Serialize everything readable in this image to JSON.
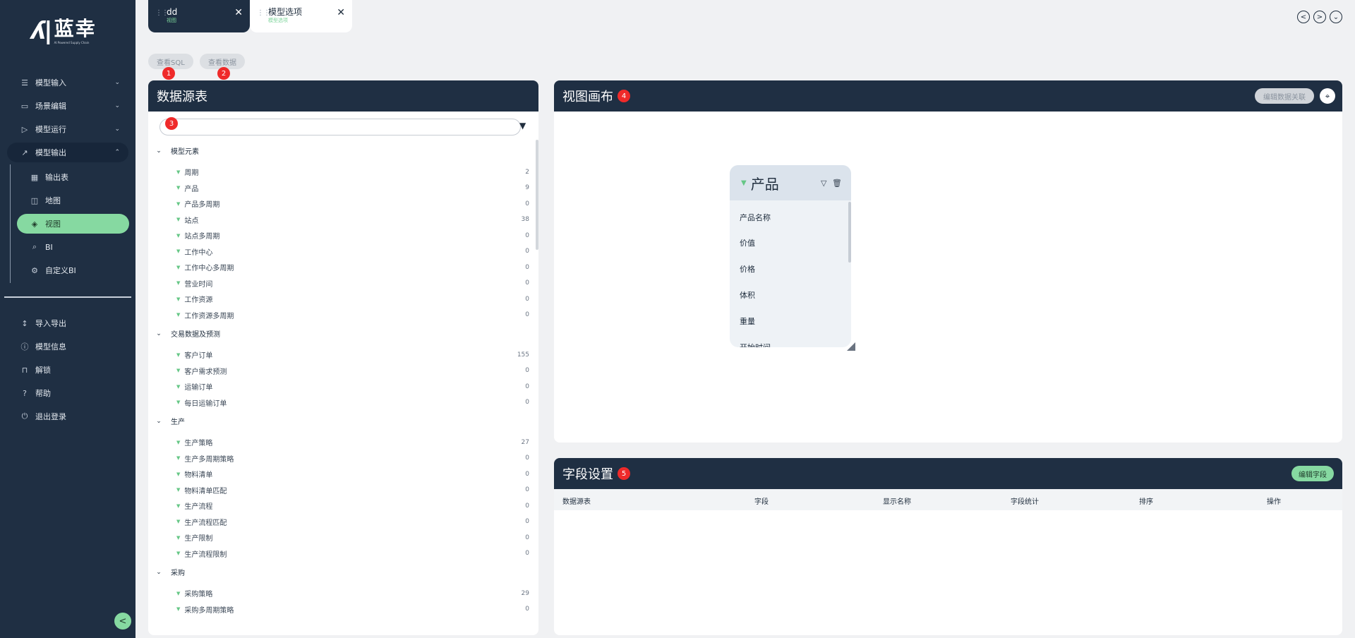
{
  "brand": {
    "name": "蓝幸",
    "mark": "ʎ|",
    "tagline": "AI Powered Supply Chain"
  },
  "sidebar": {
    "items": [
      {
        "label": "模型输入",
        "icon": "list-icon",
        "glyph": "☰",
        "chevron": "⌄"
      },
      {
        "label": "场景编辑",
        "icon": "monitor-icon",
        "glyph": "▭",
        "chevron": "⌄"
      },
      {
        "label": "模型运行",
        "icon": "play-icon",
        "glyph": "▷",
        "chevron": "⌄"
      },
      {
        "label": "模型输出",
        "icon": "chart-icon",
        "glyph": "↗",
        "chevron": "⌃"
      }
    ],
    "sub_items": [
      {
        "label": "输出表",
        "icon": "table-icon",
        "glyph": "▦"
      },
      {
        "label": "地图",
        "icon": "map-icon",
        "glyph": "◫"
      },
      {
        "label": "视图",
        "icon": "view-icon",
        "glyph": "◈"
      },
      {
        "label": "BI",
        "icon": "bi-icon",
        "glyph": "⌕"
      },
      {
        "label": "自定义BI",
        "icon": "custom-bi-icon",
        "glyph": "⚙"
      }
    ],
    "bottom_items": [
      {
        "label": "导入导出",
        "icon": "import-export-icon",
        "glyph": "↕"
      },
      {
        "label": "模型信息",
        "icon": "info-icon",
        "glyph": "ⓘ"
      },
      {
        "label": "解锁",
        "icon": "unlock-icon",
        "glyph": "⊓"
      },
      {
        "label": "帮助",
        "icon": "help-icon",
        "glyph": "?"
      },
      {
        "label": "退出登录",
        "icon": "logout-icon",
        "glyph": "⏻"
      }
    ],
    "collapse_glyph": "<"
  },
  "tabs": [
    {
      "title": "dd",
      "subtitle": "视图",
      "close": "✕"
    },
    {
      "title": "模型选项",
      "subtitle": "模型选项",
      "close": "✕"
    }
  ],
  "top_nav": {
    "prev": "<",
    "next": ">",
    "more": "⌄"
  },
  "toolbar": {
    "view_sql": "查看SQL",
    "view_data": "查看数据",
    "badge1": "1",
    "badge2": "2"
  },
  "source_panel": {
    "title": "数据源表",
    "search_badge": "3",
    "search_placeholder": "",
    "filter_glyph": "▼",
    "groups": [
      {
        "label": "模型元素",
        "items": [
          {
            "name": "周期",
            "count": "2"
          },
          {
            "name": "产品",
            "count": "9"
          },
          {
            "name": "产品多周期",
            "count": "0"
          },
          {
            "name": "站点",
            "count": "38"
          },
          {
            "name": "站点多周期",
            "count": "0"
          },
          {
            "name": "工作中心",
            "count": "0"
          },
          {
            "name": "工作中心多周期",
            "count": "0"
          },
          {
            "name": "营业时间",
            "count": "0"
          },
          {
            "name": "工作资源",
            "count": "0"
          },
          {
            "name": "工作资源多周期",
            "count": "0"
          }
        ]
      },
      {
        "label": "交易数据及预测",
        "items": [
          {
            "name": "客户订单",
            "count": "155"
          },
          {
            "name": "客户需求预测",
            "count": "0"
          },
          {
            "name": "运输订单",
            "count": "0"
          },
          {
            "name": "每日运输订单",
            "count": "0"
          }
        ]
      },
      {
        "label": "生产",
        "items": [
          {
            "name": "生产策略",
            "count": "27"
          },
          {
            "name": "生产多周期策略",
            "count": "0"
          },
          {
            "name": "物料清单",
            "count": "0"
          },
          {
            "name": "物料清单匹配",
            "count": "0"
          },
          {
            "name": "生产流程",
            "count": "0"
          },
          {
            "name": "生产流程匹配",
            "count": "0"
          },
          {
            "name": "生产限制",
            "count": "0"
          },
          {
            "name": "生产流程限制",
            "count": "0"
          }
        ]
      },
      {
        "label": "采购",
        "items": [
          {
            "name": "采购策略",
            "count": "29"
          },
          {
            "name": "采购多周期策略",
            "count": "0"
          }
        ]
      }
    ]
  },
  "canvas_panel": {
    "title": "视图画布",
    "badge": "4",
    "edit_relation": "编辑数据关联",
    "locate_glyph": "⌖",
    "node": {
      "title": "产品",
      "filter_glyph": "▽",
      "delete_glyph": "🗑",
      "fields": [
        "产品名称",
        "价值",
        "价格",
        "体积",
        "重量",
        "开始时间"
      ]
    }
  },
  "fields_panel": {
    "title": "字段设置",
    "badge": "5",
    "edit_fields": "编辑字段",
    "columns": [
      "数据源表",
      "字段",
      "显示名称",
      "字段统计",
      "排序",
      "操作"
    ]
  }
}
